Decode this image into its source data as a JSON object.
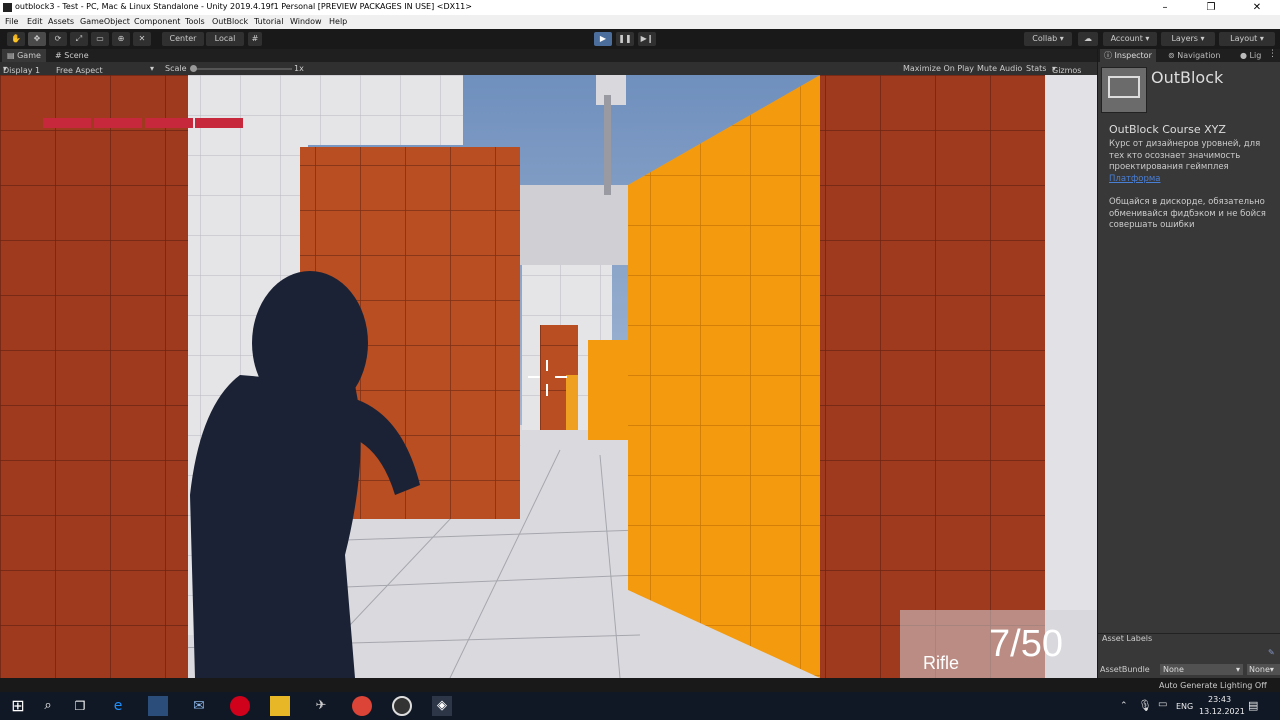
{
  "window": {
    "title": "outblock3 - Test - PC, Mac & Linux Standalone - Unity 2019.4.19f1 Personal [PREVIEW PACKAGES IN USE] <DX11>",
    "controls": [
      "–",
      "❐",
      "✕"
    ]
  },
  "menu": [
    "File",
    "Edit",
    "Assets",
    "GameObject",
    "Component",
    "Tools",
    "OutBlock",
    "Tutorial",
    "Window",
    "Help"
  ],
  "toolbar": {
    "pivot_label": "Center",
    "space_label": "Local",
    "collab_label": "Collab ▾",
    "account_label": "Account",
    "layers_label": "Layers",
    "layout_label": "Layout"
  },
  "tabs": {
    "game": "Game",
    "scene": "Scene"
  },
  "game_bar": {
    "display": "Display 1",
    "aspect": "Free Aspect",
    "scale_label": "Scale",
    "scale_value": "1x",
    "maximize": "Maximize On Play",
    "mute": "Mute Audio",
    "stats": "Stats",
    "gizmos": "Gizmos"
  },
  "hud": {
    "weapon": "Rifle",
    "ammo": "7/50",
    "health_segments": 4,
    "health_color": "#c8283c"
  },
  "inspector": {
    "tabs": [
      "Inspector",
      "Navigation",
      "Lig"
    ],
    "object_name": "OutBlock",
    "course_title": "OutBlock Course XYZ",
    "desc1": "Курс от дизайнеров уровней, для тех кто осознает значимость проектирования геймплея",
    "link": "Платформа",
    "desc2": "Общайся в дискорде, обязательно обменивайся фидбэком и не бойся совершать ошибки",
    "asset_labels": "Asset Labels",
    "assetbundle_label": "AssetBundle",
    "assetbundle_value": "None",
    "assetbundle_variant": "None"
  },
  "status": {
    "lighting": "Auto Generate Lighting Off"
  },
  "taskbar": {
    "lang": "ENG",
    "time": "23:43",
    "date": "13.12.2021"
  },
  "colors": {
    "orange": "#f39a0f",
    "dark_orange": "#b84e22",
    "sky": "#8aa5c6",
    "play": "#4b6e9c"
  }
}
